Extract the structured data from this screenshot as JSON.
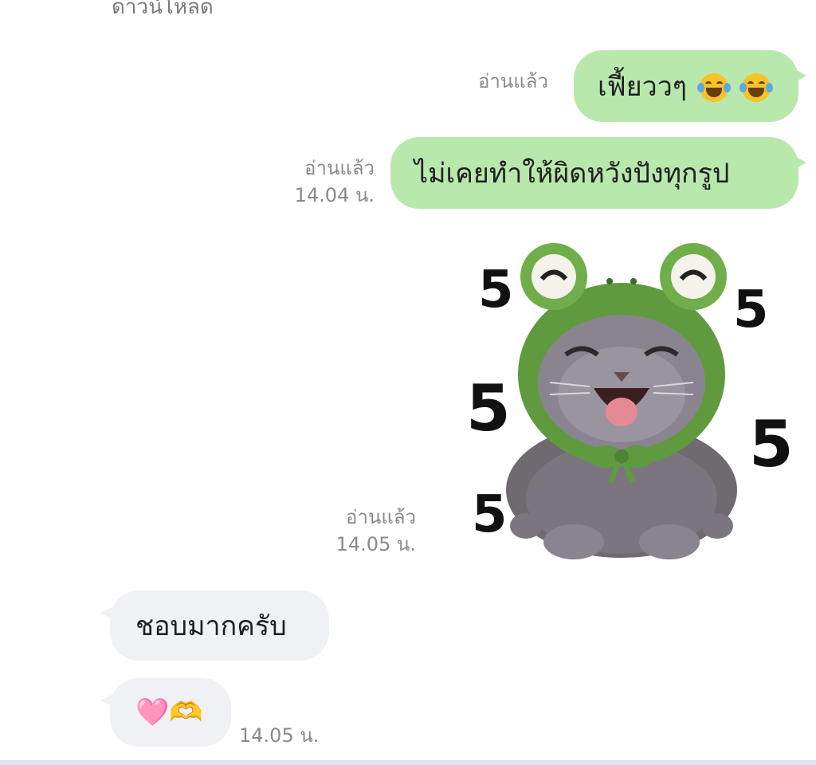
{
  "chat": {
    "cut_off_text": "ดาวน์โหลด",
    "messages": [
      {
        "side": "out",
        "text": "เฟี้ยววๆ",
        "emoji": "😂😂",
        "read": "อ่านแล้ว",
        "time": ""
      },
      {
        "side": "out",
        "text": "ไม่เคยทำให้ผิดหวังปังทุกรูป",
        "read": "อ่านแล้ว",
        "time": "14.04 น."
      },
      {
        "side": "out",
        "type": "sticker",
        "sticker_icon": "cat-in-frog-hat-laughing-sticker",
        "sticker_text": "5 5 5 5 5",
        "read": "อ่านแล้ว",
        "time": "14.05 น."
      },
      {
        "side": "in",
        "text": "ชอบมากครับ",
        "time": ""
      },
      {
        "side": "in",
        "text": "🩷🫶",
        "time": "14.05 น."
      }
    ]
  },
  "colors": {
    "outgoing_bubble": "#b9e8ad",
    "incoming_bubble": "#eff1f4",
    "meta_text": "#8a8a8a"
  }
}
